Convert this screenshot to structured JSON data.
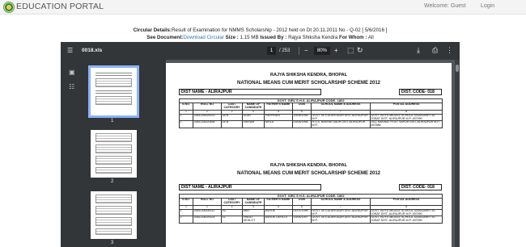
{
  "header": {
    "title": "EDUCATION PORTAL",
    "welcome": "Welcome: Guest",
    "login": "Login"
  },
  "circular": {
    "label": "Circular Details:",
    "text": "Result of Examination for NMMS Scholarship - 2012 held on Dt 20.11.2011 No - Q-02 [ 5/6/2016 ]",
    "see_label": "See Document:",
    "download_text": "Download Circular",
    "size_label": "Size :",
    "size_value": "1.15 MB",
    "issued_label": "Issued By :",
    "issued_value": "Rajya Shiksha Kendra",
    "for_label": "For Whom :",
    "for_value": "All"
  },
  "viewer": {
    "file_name": "0018.xls",
    "current_page": "1",
    "total_pages": "/ 253",
    "zoom": "80%",
    "minus": "−",
    "plus": "+",
    "thumbnails": [
      {
        "label": "1",
        "selected": true
      },
      {
        "label": "2",
        "selected": false
      },
      {
        "label": "3",
        "selected": false
      }
    ]
  },
  "document": {
    "org": "RAJYA SHIKSHA KENDRA, BHOPAL",
    "scheme": "NATIONAL MEANS CUM MERIT SCHOLARSHIP SCHEME 2012",
    "sections": [
      {
        "dist_name": "DIST NAME -   ALIRAJPUR",
        "dist_code": "DIST. CODE- 018",
        "school_caption": "GOVT. GIRL'S H.S. ALIRAJPUR CODE- 1802",
        "columns": [
          "S.NO.",
          "ROLL NO",
          "CAST CATEGORY",
          "NAME OF CANDIDATE",
          "FATHER'S NAME",
          "DOB",
          "SCHOOL NAME & ADDRESS",
          "POSTAL ADDRESS"
        ],
        "column_numbers": [
          "1",
          "2",
          "3",
          "4",
          "5",
          "6",
          "7",
          "8"
        ],
        "rows": [
          [
            "1",
            "3381218020023",
            "GEN",
            "UDAY",
            "YADPRANT",
            "15/08/1998",
            "GOVT. M.S.UDAYGADH DIST-ALIRAJPUR M.P.-",
            "GOVT. BOYS MIDDLE SCHOOL UDAIGARH TEL JOBAT DIST- ALIRAJPUR M.P.-457990"
          ],
          [
            "2",
            "3381218020488",
            "GEN",
            "VIKRAM",
            "NIRLA",
            "03/06/1998",
            "H.S.S. BAKHATGADH DIST-ALIRAJPUR M.P.-",
            "VILL KAKWAT POST VAPUR DIST-ALIRAJPUR M.P.- 457888"
          ]
        ]
      },
      {
        "dist_name": "DIST NAME -   ALIRAJPUR",
        "dist_code": "DIST. CODE- 018",
        "school_caption": "GOVT. GIRL'S H.S. ALIRAJPUR CODE- 1802",
        "columns": [
          "S.NO.",
          "ROLL NO",
          "CAST CATEGORY",
          "NAME OF CANDIDATE",
          "FATHER'S NAME",
          "DOB",
          "SCHOOL NAME & ADDRESS",
          "POSTAL ADDRESS"
        ],
        "column_numbers": [
          "1",
          "2",
          "3",
          "4",
          "5",
          "6",
          "7",
          "8"
        ],
        "rows": [
          [
            "1",
            "3381218000012",
            "SC",
            "AMIT",
            "ASHOK",
            "01/01/1998",
            "GOVT. M.S.UDAYGADH DIST-ALIRAJPUR M.P.-",
            "GOVT. BOYS MIDDLE SCHOOL UDAIGARH TEL JOBAT DIST- ALIRAJPUR M.P.-457990"
          ],
          [
            "2",
            "3381218020024",
            "SC",
            "VINOD GEHLOT",
            "ASHOK GEHLOT",
            "15/06/1997",
            "GOVT. M.S.UDAYGADH DIST-ALIRAJPUR M.P.-",
            "GOVT. BOYS MIDDLE SCHOOL UDAIGARH TEL JOBAT DIST- ALIRAJPUR M.P.-457990"
          ]
        ]
      }
    ]
  }
}
